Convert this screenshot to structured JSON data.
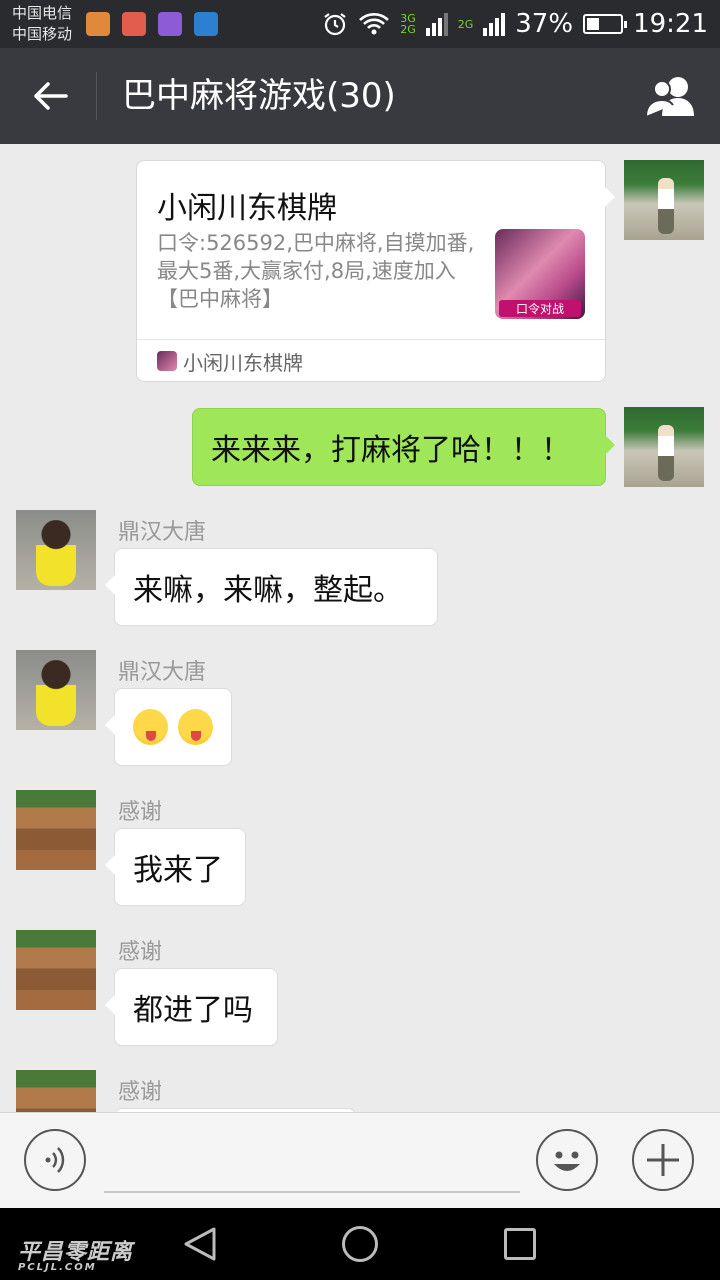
{
  "status_bar": {
    "carrier_1": "中国电信",
    "carrier_2": "中国移动",
    "net_top": "3G",
    "net_bottom": "2G",
    "net_2": "2G",
    "battery": "37%",
    "battery_level": 0.37,
    "time": "19:21"
  },
  "header": {
    "title": "巴中麻将游戏(30)",
    "back_icon": "arrow-left-icon",
    "members_icon": "group-members-icon"
  },
  "messages": [
    {
      "type": "card",
      "from": "me",
      "title": "小闲川东棋牌",
      "description": "口令:526592,巴中麻将,自摸加番,最大5番,大赢家付,8局,速度加入【巴中麻将】",
      "thumb_badge": "口令对战",
      "source": "小闲川东棋牌"
    },
    {
      "type": "text",
      "from": "me",
      "text": "来来来，打麻将了哈！！！"
    },
    {
      "type": "text",
      "from": "other",
      "sender": "鼎汉大唐",
      "text": "来嘛，来嘛，整起。"
    },
    {
      "type": "emoji",
      "from": "other",
      "sender": "鼎汉大唐",
      "emoji": [
        "wink-tongue-emoji",
        "wink-tongue-emoji"
      ]
    },
    {
      "type": "text",
      "from": "other",
      "sender": "感谢",
      "text": "我来了"
    },
    {
      "type": "text",
      "from": "other",
      "sender": "感谢",
      "text": "都进了吗"
    },
    {
      "type": "text",
      "from": "other",
      "sender": "感谢",
      "text": ""
    }
  ],
  "input_bar": {
    "voice_icon": "voice-icon",
    "emoji_icon": "smiley-icon",
    "plus_icon": "plus-icon"
  },
  "nav_bar": {
    "watermark": "平昌零距离",
    "watermark_sub": "PCLJL.COM"
  }
}
